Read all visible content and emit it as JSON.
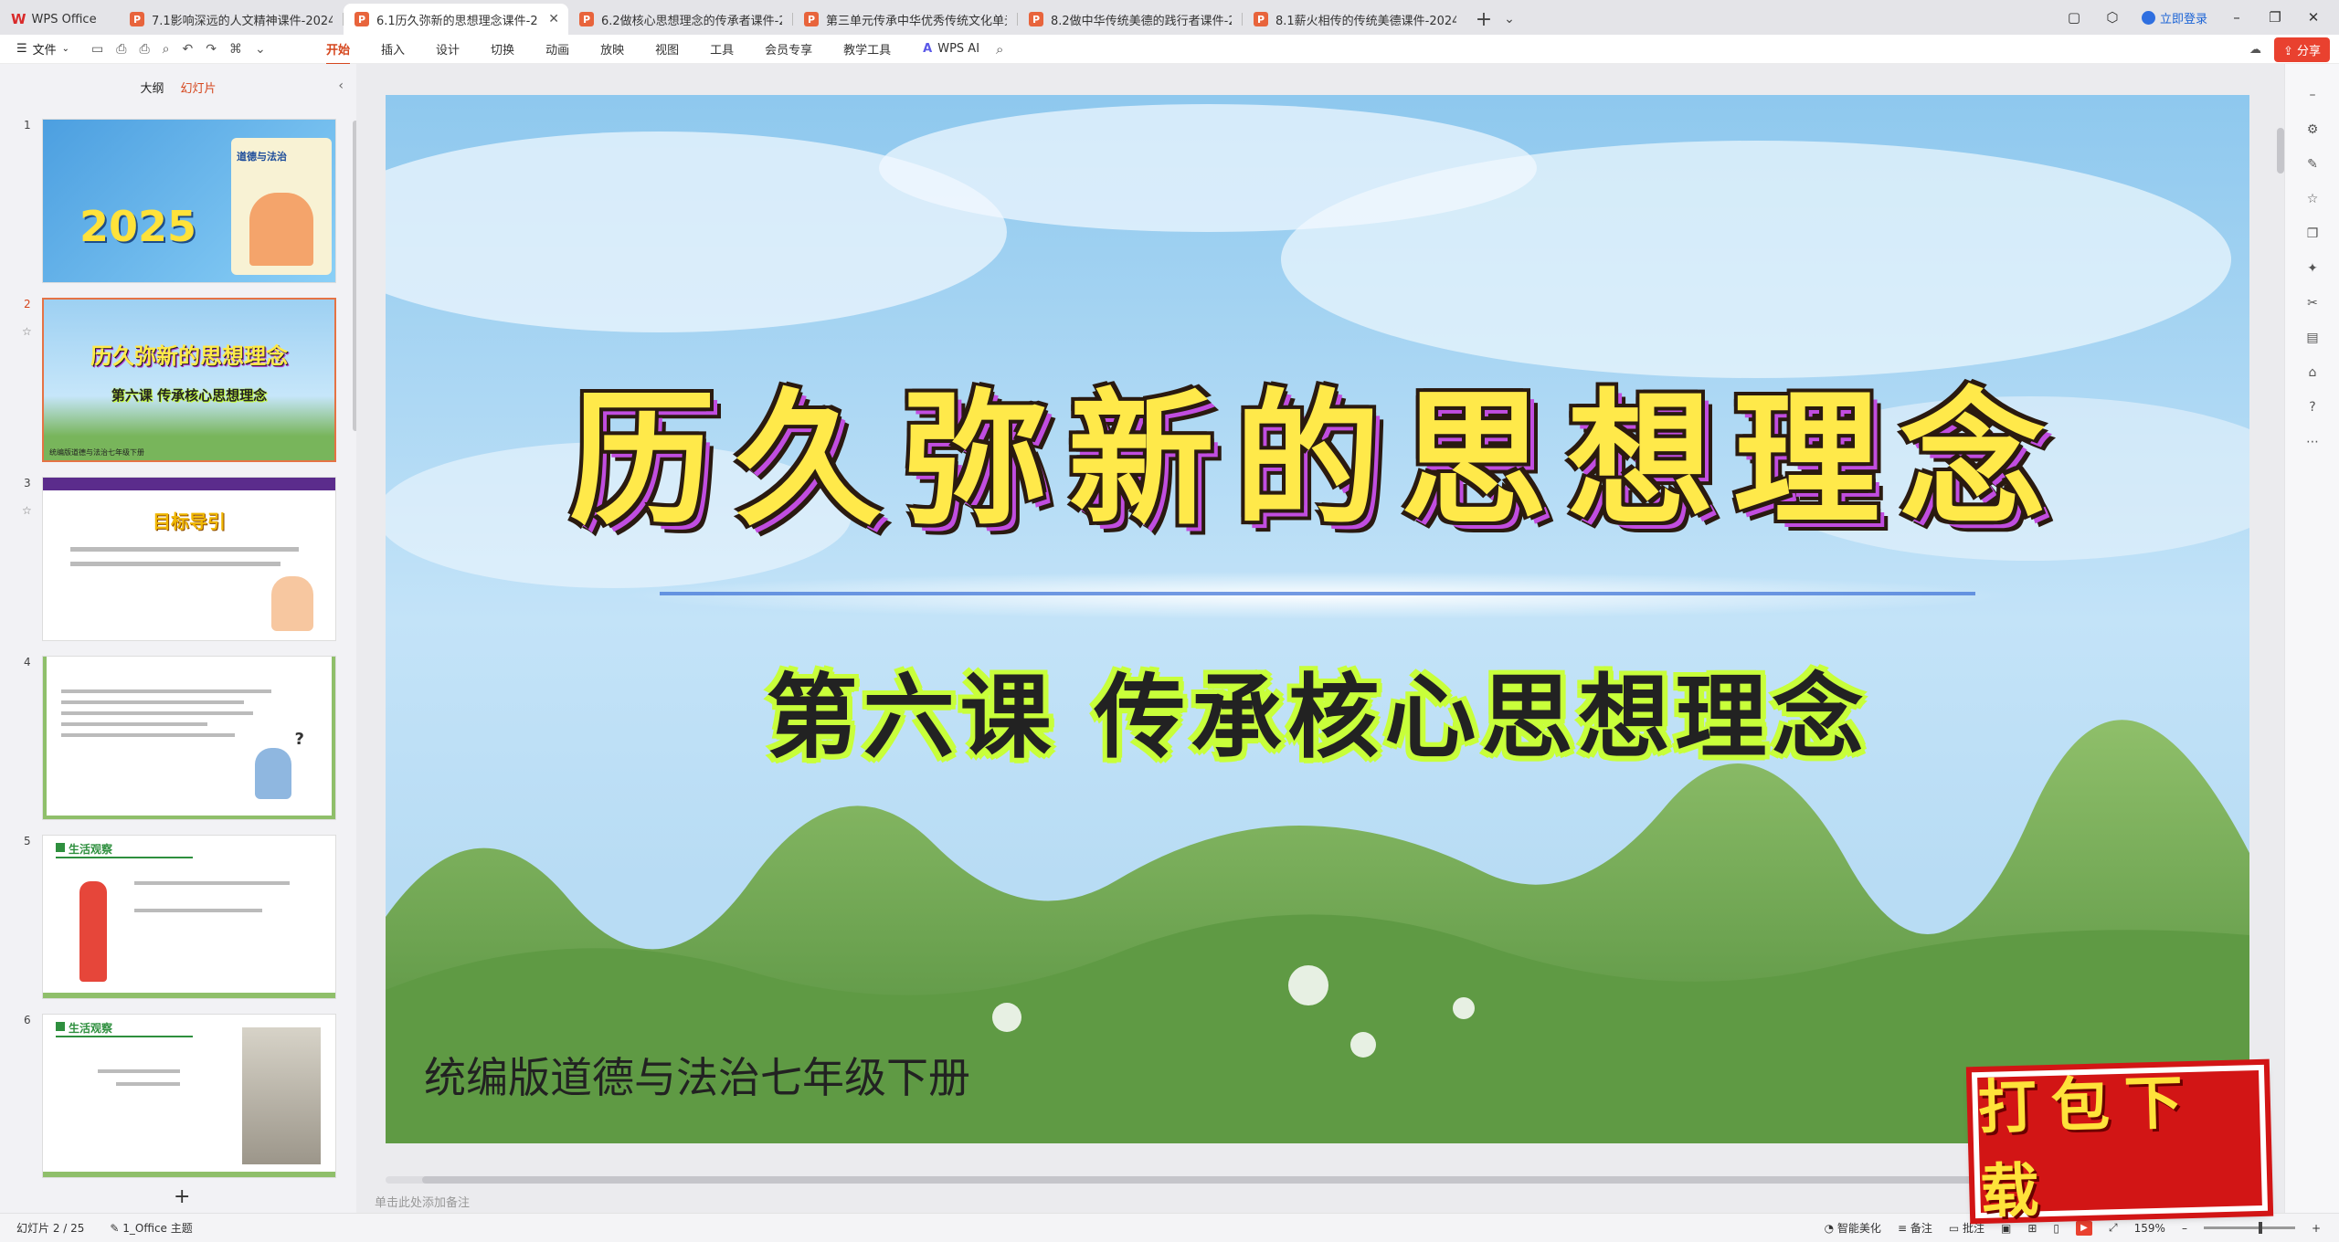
{
  "tabs": {
    "home": "WPS Office",
    "docs": [
      {
        "label": "7.1影响深远的人文精神课件-2024-20",
        "active": false
      },
      {
        "label": "6.1历久弥新的思想理念课件-2",
        "active": true
      },
      {
        "label": "6.2做核心思想理念的传承者课件-202",
        "active": false
      },
      {
        "label": "第三单元传承中华优秀传统文化单元",
        "active": false
      },
      {
        "label": "8.2做中华传统美德的践行者课件-202",
        "active": false
      },
      {
        "label": "8.1薪火相传的传统美德课件-2024-20",
        "active": false
      }
    ],
    "ppt_glyph": "P",
    "add": "+",
    "dropdown": "⌄"
  },
  "titlebar": {
    "login": "立即登录",
    "minimize": "–",
    "restore": "❐",
    "close": "✕"
  },
  "ribbon": {
    "file": "文件",
    "tabs": [
      "开始",
      "插入",
      "设计",
      "切换",
      "动画",
      "放映",
      "视图",
      "工具",
      "会员专享",
      "教学工具"
    ],
    "active_tab": "开始",
    "wps_ai": "WPS AI",
    "share": "分享"
  },
  "leftpanel": {
    "tab_outline": "大纲",
    "tab_slides": "幻灯片",
    "add": "+",
    "slides": [
      {
        "num": "1",
        "year": "2025",
        "book_title": "道德与法治"
      },
      {
        "num": "2",
        "title": "历久弥新的思想理念",
        "subtitle": "第六课 传承核心思想理念",
        "foot": "统编版道德与法治七年级下册"
      },
      {
        "num": "3",
        "title": "目标导引"
      },
      {
        "num": "4"
      },
      {
        "num": "5",
        "header": "生活观察"
      },
      {
        "num": "6",
        "header": "生活观察"
      }
    ]
  },
  "slide": {
    "title": "历久弥新的思想理念",
    "subtitle": "第六课 传承核心思想理念",
    "footer": "统编版道德与法治七年级下册"
  },
  "notes_placeholder": "单击此处添加备注",
  "statusbar": {
    "slide_pos": "幻灯片 2 / 25",
    "theme": "1_Office 主题",
    "beautify": "智能美化",
    "notes": "备注",
    "comments": "批注",
    "zoom": "159%"
  },
  "download_badge": "打包下载",
  "colors": {
    "accent": "#d5461d",
    "title_yellow": "#ffe94a",
    "title_shadow": "#c14de0",
    "subtitle_glow": "#c8ff3a",
    "share_red": "#e9412f"
  }
}
